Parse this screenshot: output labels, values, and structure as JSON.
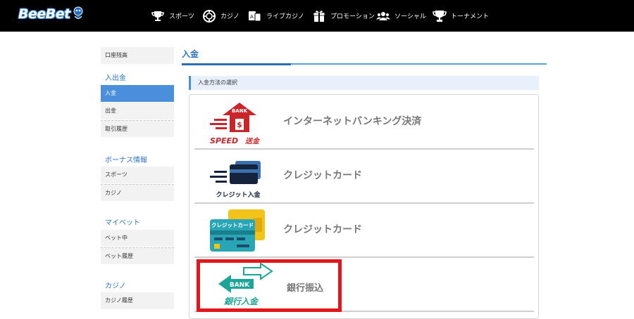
{
  "header": {
    "logo_text": "BeeBet",
    "nav": [
      {
        "label": "スポーツ",
        "icon": "trophy-icon"
      },
      {
        "label": "カジノ",
        "icon": "poker-chip-icon"
      },
      {
        "label": "ライブカジノ",
        "icon": "live-casino-icon"
      },
      {
        "label": "プロモーション",
        "icon": "gift-icon"
      },
      {
        "label": "ソーシャル",
        "icon": "people-icon"
      },
      {
        "label": "トーナメント",
        "icon": "cup-icon"
      }
    ]
  },
  "sidebar": {
    "top_item": "口座残高",
    "sections": [
      {
        "title": "入出金",
        "items": [
          "入金",
          "出金",
          "取引履歴"
        ],
        "active": "入金"
      },
      {
        "title": "ボーナス情報",
        "items": [
          "スポーツ",
          "カジノ"
        ]
      },
      {
        "title": "マイベット",
        "items": [
          "ベット中",
          "ベット履歴"
        ]
      },
      {
        "title": "カジノ",
        "items": [
          "カジノ履歴"
        ]
      }
    ]
  },
  "main": {
    "title": "入金",
    "section_label": "入金方法の選択",
    "methods": [
      {
        "label": "インターネットバンキング決済",
        "art_text_top": "BANK",
        "art_text_bottom": "SPEED",
        "art_text_badge": "送金",
        "icon": "bank-house-icon"
      },
      {
        "label": "クレジットカード",
        "art_text": "クレジット入金",
        "icon": "credit-card-speed-icon"
      },
      {
        "label": "クレジットカード",
        "art_text": "クレジットカード",
        "icon": "credit-cards-icon"
      },
      {
        "label": "銀行振込",
        "art_text_top": "BANK",
        "art_text_bottom": "銀行入金",
        "icon": "bank-transfer-arrows-icon"
      }
    ],
    "highlighted_method": "銀行振込"
  },
  "colors": {
    "accent_blue": "#2e74c4",
    "active_item": "#4a8fdb",
    "highlight_red": "#e3161c",
    "bank_red": "#c8262a",
    "card_teal": "#29a6b5",
    "bank_green": "#1aa596"
  }
}
